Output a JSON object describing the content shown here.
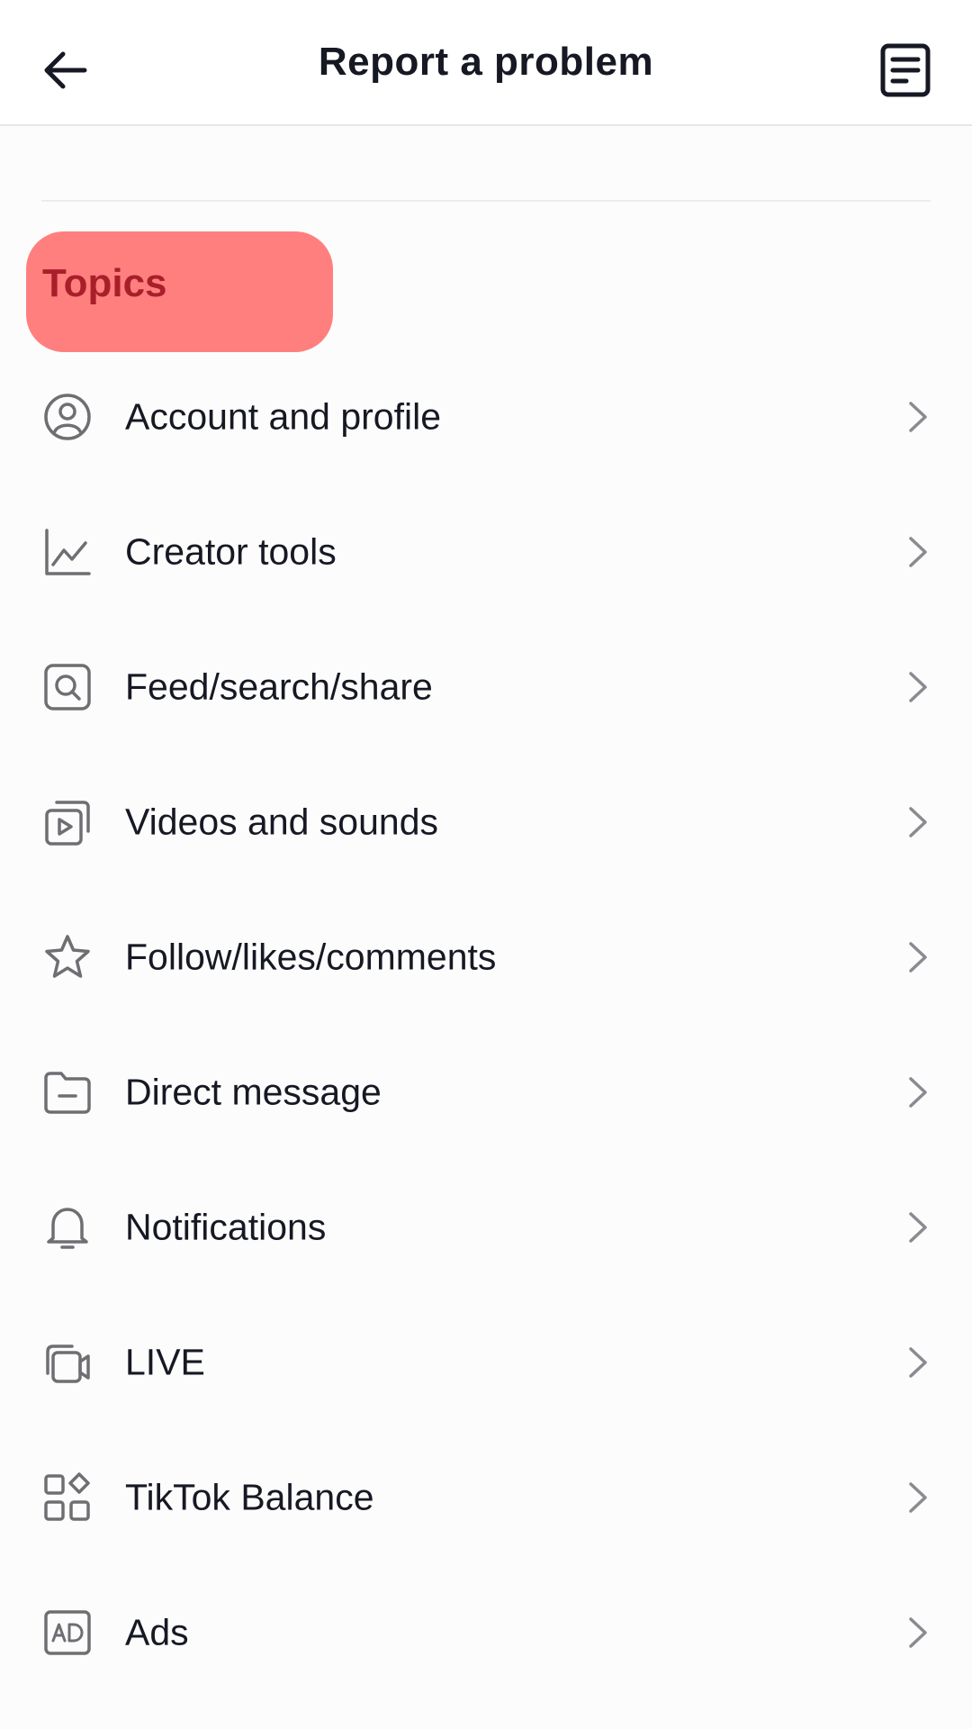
{
  "header": {
    "title": "Report a problem",
    "back_icon": "arrow-left-icon",
    "history_icon": "document-list-icon"
  },
  "section": {
    "title": "Topics",
    "highlight_color": "#ff7f7f",
    "title_color": "#a81f2a"
  },
  "topics": [
    {
      "label": "Account and profile",
      "icon": "user-circle-icon"
    },
    {
      "label": "Creator tools",
      "icon": "line-chart-icon"
    },
    {
      "label": "Feed/search/share",
      "icon": "search-square-icon"
    },
    {
      "label": "Videos and sounds",
      "icon": "video-play-icon"
    },
    {
      "label": "Follow/likes/comments",
      "icon": "star-icon"
    },
    {
      "label": "Direct message",
      "icon": "folder-minus-icon"
    },
    {
      "label": "Notifications",
      "icon": "bell-icon"
    },
    {
      "label": "LIVE",
      "icon": "video-camera-icon"
    },
    {
      "label": "TikTok Balance",
      "icon": "apps-grid-icon"
    },
    {
      "label": "Ads",
      "icon": "ad-badge-icon"
    }
  ],
  "colors": {
    "text": "#161823",
    "icon_gray": "#6e6e73",
    "chevron_gray": "#8a8b91"
  }
}
